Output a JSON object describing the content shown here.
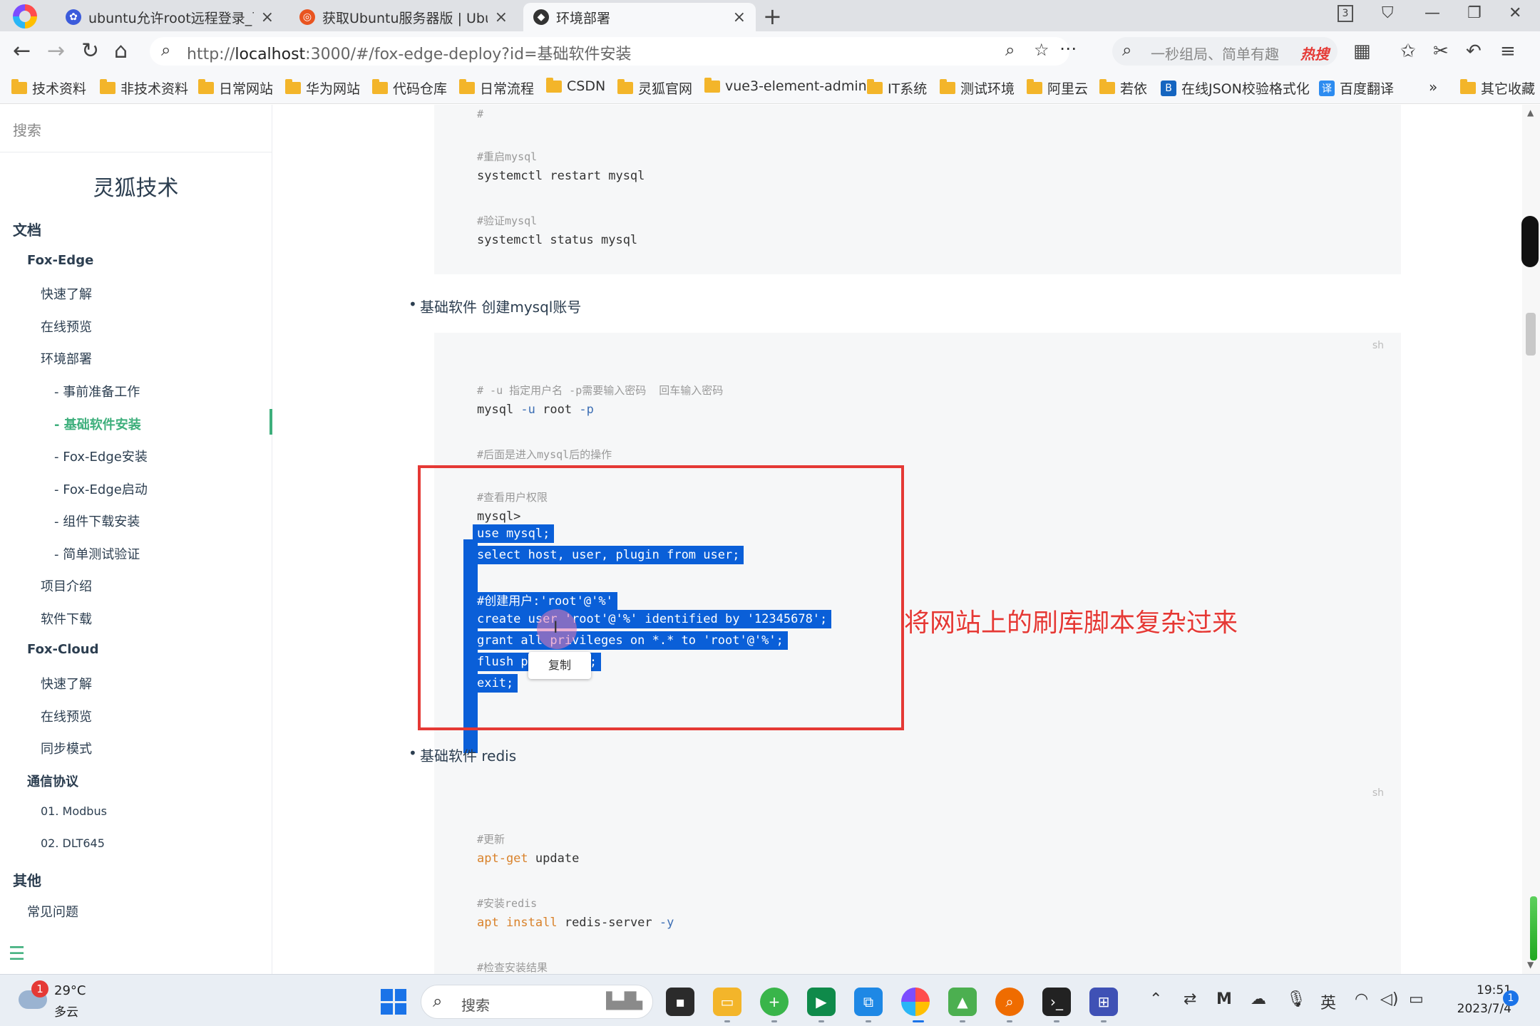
{
  "browser": {
    "tabs": [
      {
        "title": "ubuntu允许root远程登录_百",
        "close": "×"
      },
      {
        "title": "获取Ubuntu服务器版 | Ubun",
        "close": "×"
      },
      {
        "title": "环境部署",
        "close": "×"
      }
    ],
    "new_tab": "+",
    "tab_count": "3",
    "url": "http://localhost:3000/#/fox-edge-deploy?id=基础软件安装",
    "url_host": "localhost",
    "url_prefix": "http://",
    "url_suffix": ":3000/#/fox-edge-deploy?id=基础软件安装",
    "search_placeholder": "一秒组局、简单有趣",
    "search_hot": "热搜",
    "accent": "#3eaf7c"
  },
  "bookmarks": [
    "技术资料",
    "非技术资料",
    "日常网站",
    "华为网站",
    "代码仓库",
    "日常流程",
    "CSDN",
    "灵狐官网",
    "vue3-element-admin",
    "IT系统",
    "测试环境",
    "阿里云",
    "若依",
    "在线JSON校验格式化",
    "百度翻译"
  ],
  "bookmarks_more": "»",
  "bookmarks_other": "其它收藏",
  "sidebar": {
    "search_label": "搜索",
    "site_title": "灵狐技术",
    "sections": {
      "docs": "文档",
      "fox_edge": "Fox-Edge",
      "quick": "快速了解",
      "preview": "在线预览",
      "env": "环境部署",
      "prep": "- 事前准备工作",
      "basic": "- 基础软件安装",
      "fe_install": "- Fox-Edge安装",
      "fe_start": "- Fox-Edge启动",
      "comp": "- 组件下载安装",
      "test": "- 简单测试验证",
      "intro": "项目介绍",
      "download": "软件下载",
      "fox_cloud": "Fox-Cloud",
      "fc_quick": "快速了解",
      "fc_preview": "在线预览",
      "fc_sync": "同步模式",
      "protocol": "通信协议",
      "modbus": "01. Modbus",
      "dlt": "02. DLT645",
      "other": "其他",
      "faq": "常见问题"
    }
  },
  "content": {
    "block1": {
      "l1": "#",
      "l2": "#重启mysql",
      "l3": "systemctl restart mysql",
      "l4": "#验证mysql",
      "l5": "systemctl status mysql"
    },
    "bullet1": "基础软件 创建mysql账号",
    "block2": {
      "lang": "sh",
      "c1": "# -u 指定用户名 -p需要输入密码  回车输入密码",
      "l1a": "mysql ",
      "l1b": "-u",
      "l1c": " root ",
      "l1d": "-p",
      "c2": "#后面是进入mysql后的操作",
      "c3": "#查看用户权限",
      "l2": "mysql>",
      "s1": "use mysql;",
      "s2": "select host, user, plugin from user;",
      "s3": "#创建用户:'root'@'%'",
      "s4": "create user 'root'@'%' identified by '12345678';",
      "s5": "grant all privileges on *.* to 'root'@'%';",
      "s6": "flush pr",
      "s6b": ";",
      "s7": "exit;"
    },
    "copy_tooltip": "复制",
    "annotation": "将网站上的刷库脚本复杂过来",
    "bullet2": "基础软件 redis",
    "block3": {
      "lang": "sh",
      "c1": "#更新",
      "l1a": "apt-get",
      "l1b": " update",
      "c2": "#安装redis",
      "l2a": "apt install",
      "l2b": " redis-server ",
      "l2c": "-y",
      "c3": "#检查安装结果"
    }
  },
  "taskbar": {
    "weather_badge": "1",
    "temperature": "29°C",
    "weather": "多云",
    "search": "搜索",
    "ime": "英",
    "time": "19:51",
    "date": "2023/7/4",
    "notifications": "1"
  }
}
